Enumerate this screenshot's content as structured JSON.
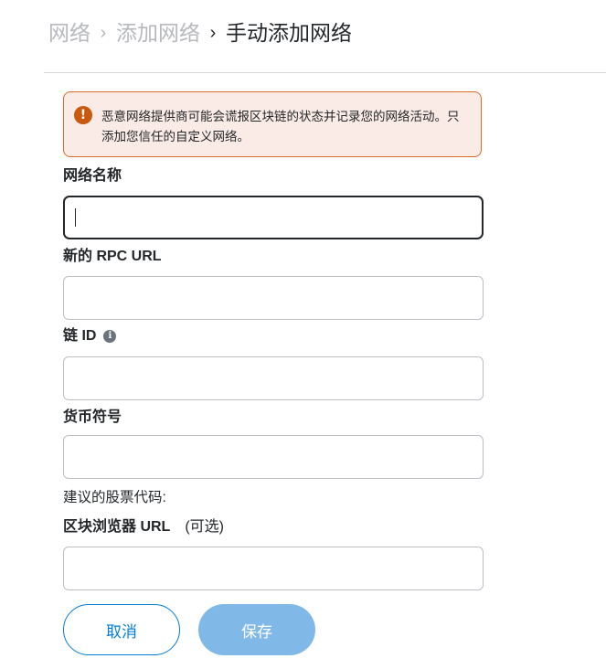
{
  "breadcrumb": {
    "item1": "网络",
    "item2": "添加网络",
    "current": "手动添加网络",
    "separator": "›"
  },
  "warning": {
    "icon": "exclamation-icon",
    "text": "恶意网络提供商可能会谎报区块链的状态并记录您的网络活动。只添加您信任的自定义网络。"
  },
  "form": {
    "network_name_label": "网络名称",
    "network_name_value": "",
    "rpc_url_label": "新的 RPC URL",
    "rpc_url_value": "",
    "chain_id_label": "链 ID",
    "chain_id_value": "",
    "currency_symbol_label": "货币符号",
    "currency_symbol_value": "",
    "suggested_ticker_hint": "建议的股票代码:",
    "explorer_url_label": "区块浏览器 URL",
    "explorer_url_optional": "(可选)",
    "explorer_url_value": ""
  },
  "buttons": {
    "cancel": "取消",
    "save": "保存"
  },
  "colors": {
    "primary": "#037dd6",
    "primary_disabled": "#80b9e8",
    "warning_border": "#d96a2b",
    "warning_bg": "#faebe6",
    "warning_icon": "#c8590e"
  }
}
